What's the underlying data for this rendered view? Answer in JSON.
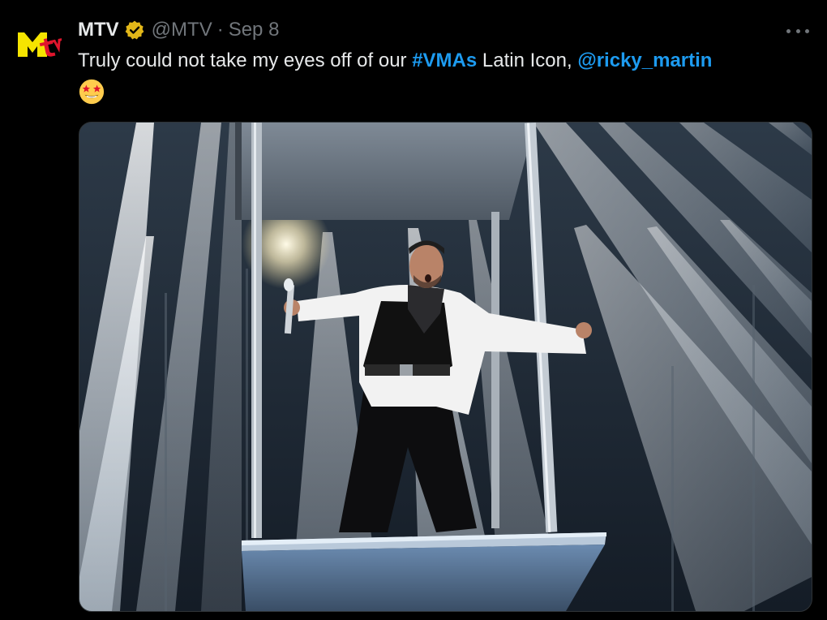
{
  "tweet": {
    "author": {
      "display_name": "MTV",
      "handle": "@MTV",
      "verified": true,
      "verified_badge_color": "#e2b719",
      "avatar_icon": "mtv-logo-icon",
      "avatar_color": "#f5e400"
    },
    "separator": "·",
    "date": "Sep 8",
    "text": {
      "part1": "Truly could not take my eyes off of our ",
      "hashtag": "#VMAs",
      "part2": " Latin Icon, ",
      "mention": "@ricky_martin",
      "emoji": "star-struck-emoji"
    },
    "media": {
      "type": "photo",
      "subject": "performer on stage platform with spotlights"
    },
    "more_icon": "more-options-icon"
  },
  "colors": {
    "background": "#000000",
    "text": "#e7e9ea",
    "secondary": "#71767b",
    "link": "#1d9bf0"
  }
}
